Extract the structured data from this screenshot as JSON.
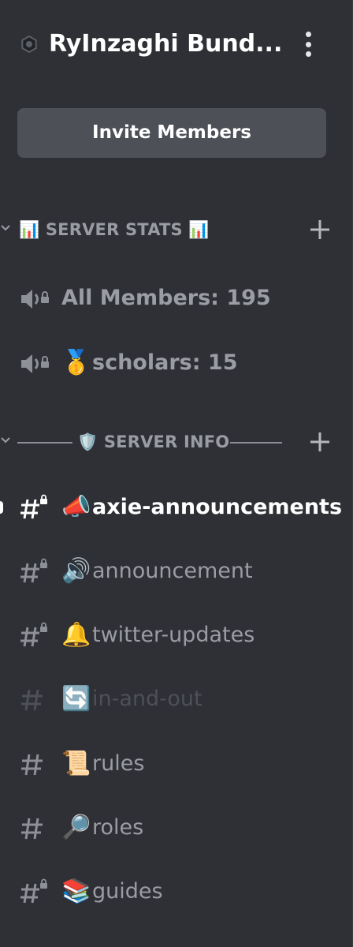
{
  "header": {
    "server_name": "RyInzaghi Bund...",
    "invite_label": "Invite Members"
  },
  "categories": [
    {
      "label": "📊 SERVER STATS 📊"
    },
    {
      "label": "🛡️ SERVER INFO"
    }
  ],
  "voice_channels": [
    {
      "emoji": "",
      "label": "All Members: 195",
      "icon": "locked-speaker-icon"
    },
    {
      "emoji": "🥇",
      "label": "scholars: 15",
      "icon": "locked-speaker-icon"
    }
  ],
  "text_channels": [
    {
      "emoji": "📣",
      "label": "axie-announcements",
      "icon": "locked-hash-icon",
      "state": "active"
    },
    {
      "emoji": "🔊",
      "label": "announcement",
      "icon": "locked-hash-icon",
      "state": "normal"
    },
    {
      "emoji": "🔔",
      "label": "twitter-updates",
      "icon": "locked-hash-icon",
      "state": "normal"
    },
    {
      "emoji": "🔄",
      "label": "in-and-out",
      "icon": "hash-icon",
      "state": "muted"
    },
    {
      "emoji": "📜",
      "label": "rules",
      "icon": "hash-icon",
      "state": "normal"
    },
    {
      "emoji": "🔎",
      "label": "roles",
      "icon": "hash-icon",
      "state": "normal"
    },
    {
      "emoji": "📚",
      "label": "guides",
      "icon": "locked-hash-icon",
      "state": "normal"
    }
  ],
  "colors": {
    "background": "#2e3035",
    "button": "#4e5058",
    "text_active": "#ffffff",
    "text_normal": "#9b9da4",
    "text_muted": "#4e5058"
  }
}
